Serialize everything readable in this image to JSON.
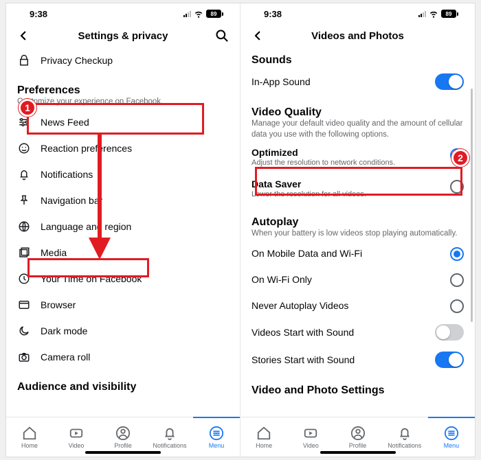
{
  "status": {
    "time": "9:38",
    "battery": "89"
  },
  "left": {
    "header_title": "Settings & privacy",
    "privacy_checkup": "Privacy Checkup",
    "prefs_title": "Preferences",
    "prefs_sub": "Customize your experience on Facebook.",
    "items": {
      "news_feed": "News Feed",
      "reaction": "Reaction preferences",
      "notifications": "Notifications",
      "navbar": "Navigation bar",
      "language": "Language and region",
      "media": "Media",
      "your_time": "Your Time on Facebook",
      "browser": "Browser",
      "dark": "Dark mode",
      "camera": "Camera roll"
    },
    "audience_title": "Audience and visibility"
  },
  "right": {
    "header_title": "Videos and Photos",
    "sounds_title": "Sounds",
    "inapp_sound": "In-App Sound",
    "vq_title": "Video Quality",
    "vq_sub": "Manage your default video quality and the amount of cellular data you use with the following options.",
    "optimized": "Optimized",
    "optimized_sub": "Adjust the resolution to network conditions.",
    "datasaver": "Data Saver",
    "datasaver_sub": "Lower the resolution for all videos.",
    "autoplay_title": "Autoplay",
    "autoplay_sub": "When your battery is low videos stop playing automatically.",
    "ap_mobile": "On Mobile Data and Wi-Fi",
    "ap_wifi": "On Wi-Fi Only",
    "ap_never": "Never Autoplay Videos",
    "vstart": "Videos Start with Sound",
    "sstart": "Stories Start with Sound",
    "vps_title": "Video and Photo Settings"
  },
  "tabs": {
    "home": "Home",
    "video": "Video",
    "profile": "Profile",
    "notif": "Notifications",
    "menu": "Menu"
  },
  "annotations": {
    "badge1": "1",
    "badge2": "2"
  }
}
